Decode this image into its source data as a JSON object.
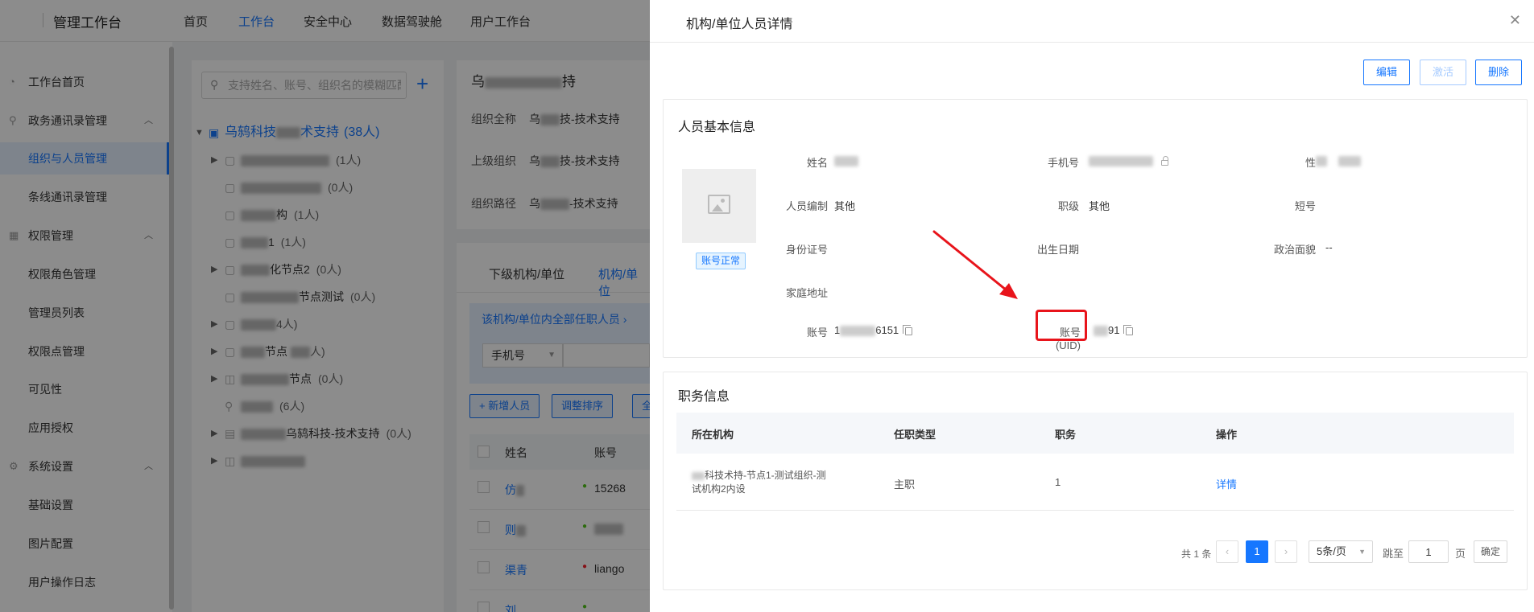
{
  "topbar": {
    "app_title": "管理工作台",
    "nav": [
      "首页",
      "工作台",
      "安全中心",
      "数据驾驶舱",
      "用户工作台"
    ],
    "active_nav": "工作台"
  },
  "sidebar": {
    "items": [
      {
        "label": "工作台首页",
        "icon": "dashboard-icon"
      },
      {
        "label": "政务通讯录管理",
        "icon": "org-tree-icon"
      },
      {
        "label": "组织与人员管理"
      },
      {
        "label": "条线通讯录管理"
      },
      {
        "label": "权限管理",
        "icon": "grid-icon"
      },
      {
        "label": "权限角色管理"
      },
      {
        "label": "管理员列表"
      },
      {
        "label": "权限点管理"
      },
      {
        "label": "可见性"
      },
      {
        "label": "应用授权"
      },
      {
        "label": "系统设置",
        "icon": "gear-icon"
      },
      {
        "label": "基础设置"
      },
      {
        "label": "图片配置"
      },
      {
        "label": "用户操作日志"
      }
    ]
  },
  "tree": {
    "search_placeholder": "支持姓名、账号、组织名的模糊匹配",
    "root": {
      "label_a": "乌鸫科技",
      "label_b": "术支持",
      "count": "(38人)"
    },
    "nodes": [
      {
        "suffix": "",
        "count": "(1人)"
      },
      {
        "suffix": "",
        "count": "(0人)"
      },
      {
        "suffix": "构",
        "count": "(1人)"
      },
      {
        "suffix": "1",
        "count": "(1人)"
      },
      {
        "suffix": "化节点2",
        "count": "(0人)"
      },
      {
        "suffix": "节点测试",
        "count": "(0人)"
      },
      {
        "suffix": "",
        "count": "4人)"
      },
      {
        "suffix": "节点",
        "count": "人)"
      },
      {
        "suffix": "节点",
        "count": "(0人)"
      },
      {
        "suffix": "",
        "count": "(6人)"
      },
      {
        "suffix": "乌鸫科技-技术支持",
        "count": "(0人)"
      },
      {
        "suffix": "",
        "count": ""
      }
    ]
  },
  "org_detail": {
    "title_suffix": "持",
    "rows": [
      {
        "key": "组织全称",
        "value_a": "乌",
        "value_b": "技-技术支持"
      },
      {
        "key": "上级组织",
        "value_a": "乌",
        "value_b": "技-技术支持"
      },
      {
        "key": "组织路径",
        "value_a": "乌",
        "value_b": "-技术支持"
      }
    ]
  },
  "member_list": {
    "tabs": [
      "下级机构/单位",
      "机构/单位"
    ],
    "notice": "该机构/单位内全部任职人员",
    "filter_select": "手机号",
    "buttons": [
      "+ 新增人员",
      "调整排序",
      "全"
    ],
    "columns": [
      "姓名",
      "账号"
    ],
    "rows": [
      {
        "name": "仿",
        "status_color": "#52c41a",
        "account": "15268"
      },
      {
        "name": "则",
        "status_color": "#52c41a",
        "account": ""
      },
      {
        "name": "渠青",
        "status_color": "#f5222d",
        "account": "liango"
      },
      {
        "name": "刘",
        "status_color": "#52c41a",
        "account": ""
      }
    ]
  },
  "drawer": {
    "title": "机构/单位人员详情",
    "close_icon": "close-icon",
    "actions": {
      "edit": "编辑",
      "activate": "激活",
      "delete": "删除"
    },
    "basic_info": {
      "title": "人员基本信息",
      "status_tag": "账号正常",
      "fields": {
        "name_label": "姓名",
        "name_value": "",
        "phone_label": "手机号",
        "phone_value": "",
        "gender_label": "性",
        "gender_value": "",
        "staffing_label": "人员编制",
        "staffing_value": "其他",
        "rank_label": "职级",
        "rank_value": "其他",
        "short_no_label": "短号",
        "short_no_value": "",
        "id_card_label": "身份证号",
        "id_card_value": "",
        "birth_label": "出生日期",
        "birth_value": "",
        "politics_label": "政治面貌",
        "politics_value": "--",
        "address_label": "家庭地址",
        "address_value": "",
        "account_label": "账号",
        "account_value_a": "1",
        "account_value_b": "6151",
        "uid_label": "账号(UID)",
        "uid_value": "91"
      }
    },
    "job_info": {
      "title": "职务信息",
      "columns": [
        "所在机构",
        "任职类型",
        "职务",
        "操作"
      ],
      "rows": [
        {
          "org_line1": "科技术持-节点1-测试组织-测",
          "org_line2": "试机构2内设",
          "type": "主职",
          "position": "1",
          "action": "详情"
        }
      ]
    },
    "pagination": {
      "total": "共 1 条",
      "current_page": "1",
      "page_size": "5条/页",
      "jump_label": "跳至",
      "jump_value": "1",
      "page_unit": "页",
      "confirm": "确定"
    }
  },
  "colors": {
    "accent": "#1677ff",
    "annotation": "#e8141b"
  }
}
